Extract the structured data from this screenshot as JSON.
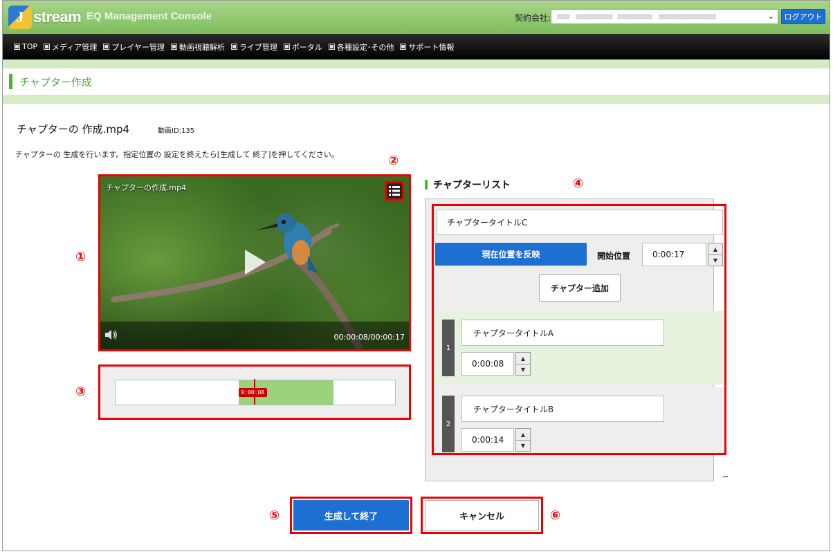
{
  "header": {
    "logo_text": "stream",
    "logo_letter": "J",
    "console_title": "EQ Management Console",
    "contract_label": "契約会社:",
    "contract_value": "",
    "logout_label": "ログアウト"
  },
  "nav": {
    "items": [
      {
        "label": "TOP"
      },
      {
        "label": "メディア管理"
      },
      {
        "label": "プレイヤー管理"
      },
      {
        "label": "動画視聴解析"
      },
      {
        "label": "ライブ管理"
      },
      {
        "label": "ポータル"
      },
      {
        "label": "各種設定･その他"
      },
      {
        "label": "サポート情報"
      }
    ]
  },
  "page": {
    "title": "チャプター作成",
    "file_title": "チャプターの 作成.mp4",
    "video_id": "動画ID:135",
    "instructions": "チャプターの 生成を行います。指定位置の 設定を終えたら[生成して 終了]を押してください。"
  },
  "player": {
    "title": "チャプターの作成.mp4",
    "timecode": "00:00:08/00:00:17"
  },
  "timeline": {
    "badge": "0:00:08",
    "range_start_fraction": 0.44,
    "range_end_fraction": 0.78,
    "cursor_fraction": 0.5
  },
  "chapter_list": {
    "heading": "チャプターリスト",
    "new_title": "チャプタータイトルC",
    "reflect_label": "現在位置を反映",
    "start_label": "開始位置",
    "start_value": "0:00:17",
    "add_label": "チャプター追加",
    "chapters": [
      {
        "number": "1",
        "title": "チャプタータイトルA",
        "time": "0:00:08"
      },
      {
        "number": "2",
        "title": "チャプタータイトルB",
        "time": "0:00:14"
      }
    ]
  },
  "actions": {
    "finish_label": "生成して終了",
    "cancel_label": "キャンセル"
  },
  "markers": [
    "①",
    "②",
    "③",
    "④",
    "⑤",
    "⑥"
  ],
  "colors": {
    "accent_blue": "#1d6fd1",
    "brand_green": "#46b52b",
    "highlight_red": "#e00000",
    "timeline_green": "#9bd37c"
  }
}
